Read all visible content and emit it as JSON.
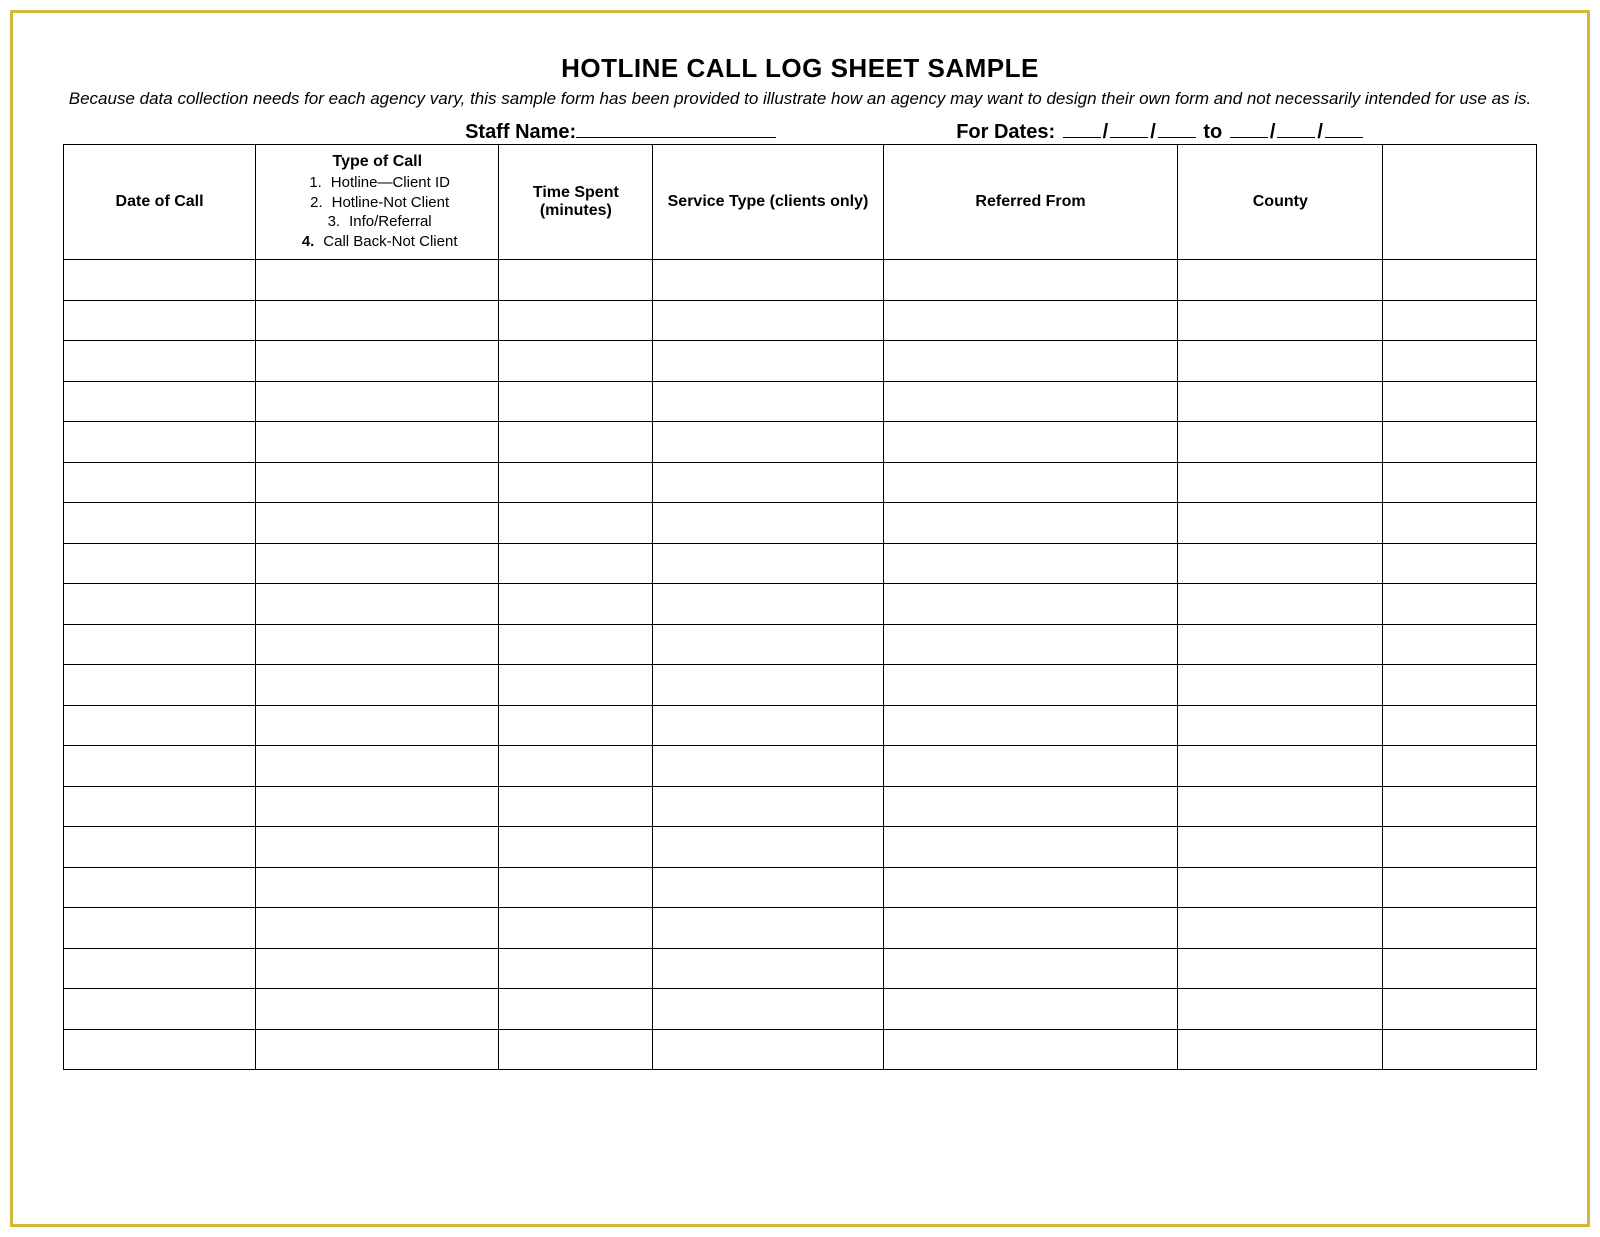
{
  "title": "HOTLINE CALL LOG SHEET SAMPLE",
  "subtitle": "Because data collection needs for each agency vary, this sample form has been provided to illustrate how an agency may want to design their own form and not necessarily intended for use as is.",
  "meta": {
    "staff_label": "Staff Name:",
    "dates_label": "For Dates:",
    "dates_sep_slash": "/",
    "dates_sep_to": "to"
  },
  "headers": {
    "date_of_call": "Date of Call",
    "type_of_call_title": "Type of Call",
    "type_options": [
      {
        "num": "1",
        "text": "Hotline—Client ID"
      },
      {
        "num": "2",
        "text": "Hotline-Not Client"
      },
      {
        "num": "3",
        "text": "Info/Referral"
      },
      {
        "num": "4",
        "text": "Call Back-Not Client"
      }
    ],
    "time_spent": "Time Spent (minutes)",
    "service_type": "Service Type (clients only)",
    "referred_from": "Referred From",
    "county": "County"
  },
  "row_count": 20
}
